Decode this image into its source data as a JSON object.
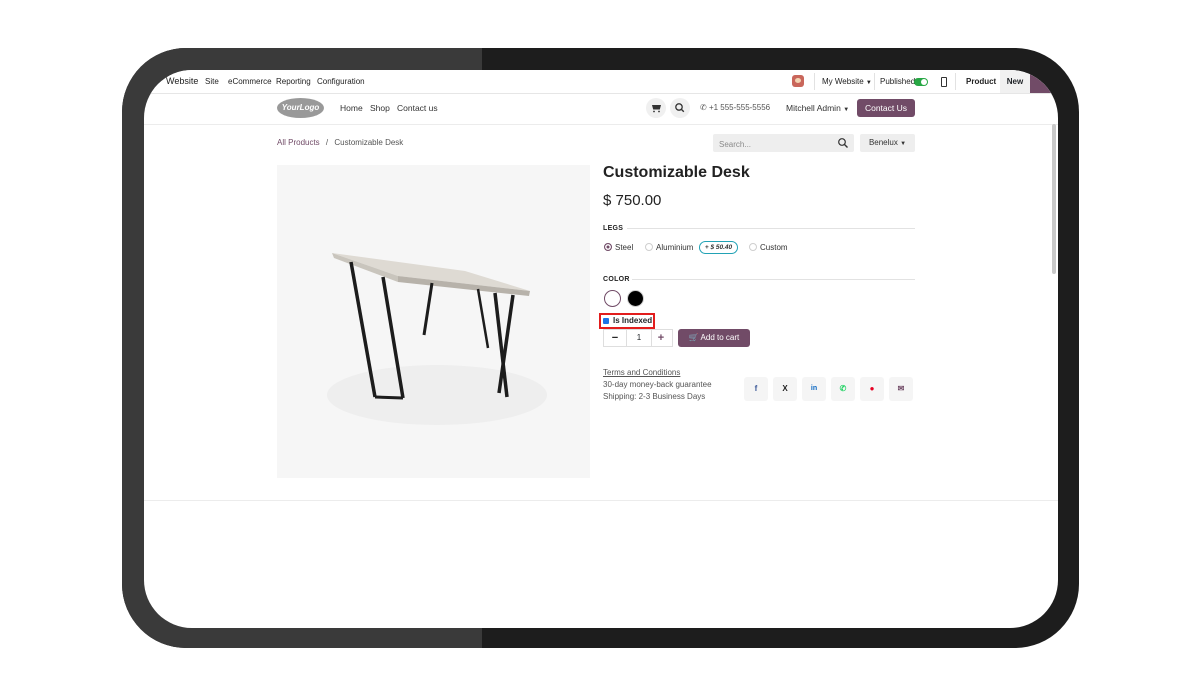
{
  "admin_bar": {
    "app_name": "Website",
    "menu": [
      "Site",
      "eCommerce",
      "Reporting",
      "Configuration"
    ],
    "website_selector": "My Website",
    "published_label": "Published",
    "published": true,
    "product_label": "Product",
    "new_label": "New"
  },
  "site_header": {
    "logo_text": "YourLogo",
    "nav": [
      "Home",
      "Shop",
      "Contact us"
    ],
    "phone": "+1 555-555-5556",
    "user": "Mitchell Admin",
    "contact_button": "Contact Us"
  },
  "breadcrumb": {
    "parent": "All Products",
    "separator": "/",
    "current": "Customizable Desk"
  },
  "search": {
    "placeholder": "Search..."
  },
  "pricelist": "Benelux",
  "product": {
    "name": "Customizable Desk",
    "price": "$ 750.00",
    "legs": {
      "label": "LEGS",
      "options": [
        "Steel",
        "Aluminium",
        "Custom"
      ],
      "selected": "Steel",
      "aluminium_extra": "+ $ 50.40"
    },
    "color": {
      "label": "COLOR",
      "swatches": [
        "#ffffff",
        "#000000"
      ],
      "selected": "#ffffff"
    },
    "is_indexed_label": "Is Indexed",
    "is_indexed_checked": true,
    "quantity": "1",
    "add_to_cart": "Add to cart",
    "terms_link": "Terms and Conditions",
    "guarantee": "30-day money-back guarantee",
    "shipping": "Shipping: 2-3 Business Days",
    "share_icons": [
      "facebook-icon",
      "x-icon",
      "linkedin-icon",
      "whatsapp-icon",
      "pinterest-icon",
      "email-icon"
    ]
  },
  "colors": {
    "brand": "#714b67",
    "toggle_on": "#28a745",
    "highlight_border": "#e21d1d"
  }
}
